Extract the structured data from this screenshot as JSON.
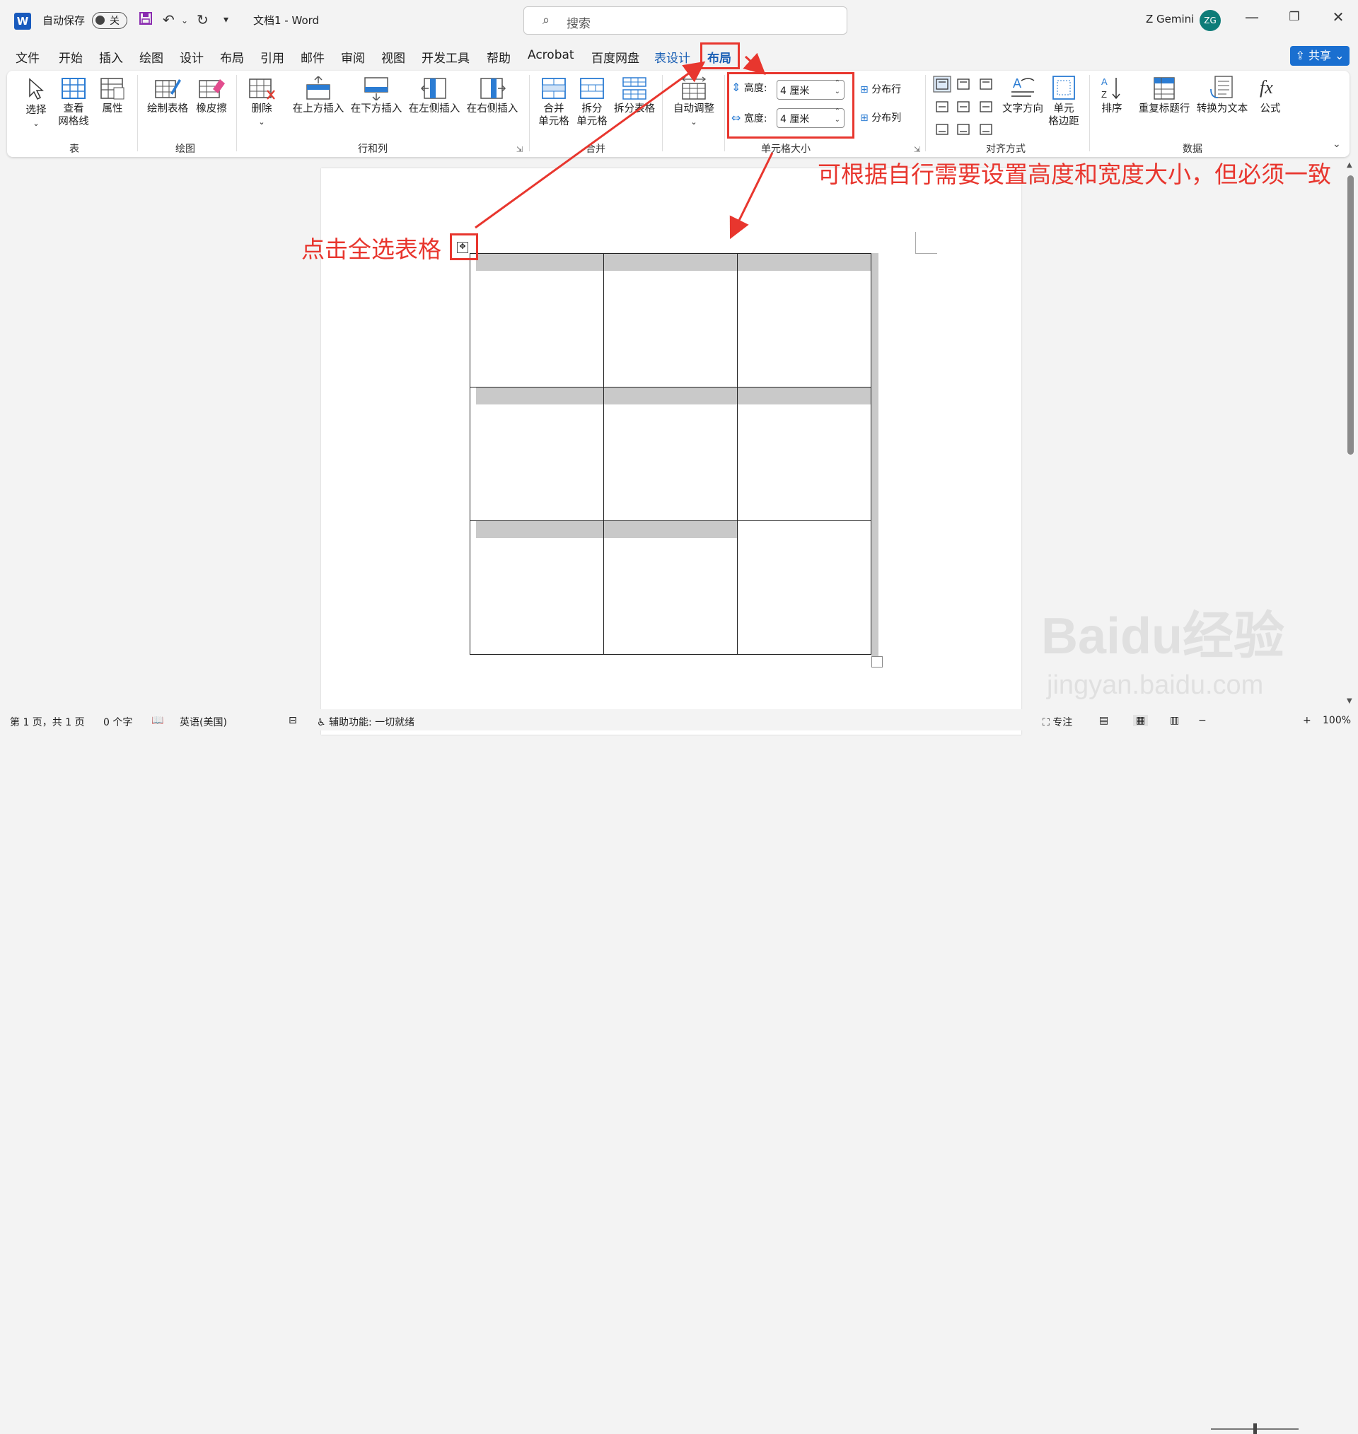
{
  "titlebar": {
    "autosave_label": "自动保存",
    "autosave_state": "关",
    "doc_title": "文档1  -  Word",
    "search_placeholder": "搜索",
    "user_name": "Z Gemini",
    "user_initials": "ZG"
  },
  "tabs": [
    "文件",
    "开始",
    "插入",
    "绘图",
    "设计",
    "布局",
    "引用",
    "邮件",
    "审阅",
    "视图",
    "开发工具",
    "帮助",
    "Acrobat",
    "百度网盘",
    "表设计",
    "布局"
  ],
  "share_label": "共享",
  "ribbon": {
    "table_group": {
      "label": "表",
      "buttons": [
        "选择",
        "查看\n网格线",
        "属性"
      ]
    },
    "draw_group": {
      "label": "绘图",
      "buttons": [
        "绘制表格",
        "橡皮擦"
      ]
    },
    "rows_cols_group": {
      "label": "行和列",
      "buttons": [
        "删除",
        "在上方插入",
        "在下方插入",
        "在左侧插入",
        "在右侧插入"
      ]
    },
    "merge_group": {
      "label": "合并",
      "buttons": [
        "合并\n单元格",
        "拆分\n单元格",
        "拆分表格"
      ]
    },
    "autofit": "自动调整",
    "cellsize_group": {
      "label": "单元格大小",
      "height_label": "高度:",
      "height_value": "4 厘米",
      "width_label": "宽度:",
      "width_value": "4 厘米",
      "dist_rows": "分布行",
      "dist_cols": "分布列"
    },
    "align_group": {
      "label": "对齐方式",
      "text_direction": "文字方向",
      "cell_margins": "单元\n格边距"
    },
    "data_group": {
      "label": "数据",
      "buttons": [
        "排序",
        "重复标题行",
        "转换为文本",
        "公式"
      ]
    }
  },
  "annotations": {
    "select_table": "点击全选表格",
    "size_note": "可根据自行需要设置高度和宽度大小，但必须一致"
  },
  "status": {
    "page": "第 1 页，共 1 页",
    "words": "0 个字",
    "language": "英语(美国)",
    "accessibility": "辅助功能: 一切就绪",
    "focus": "专注",
    "zoom": "100%"
  },
  "watermark": {
    "brand": "Baidu经验",
    "url": "jingyan.baidu.com"
  }
}
